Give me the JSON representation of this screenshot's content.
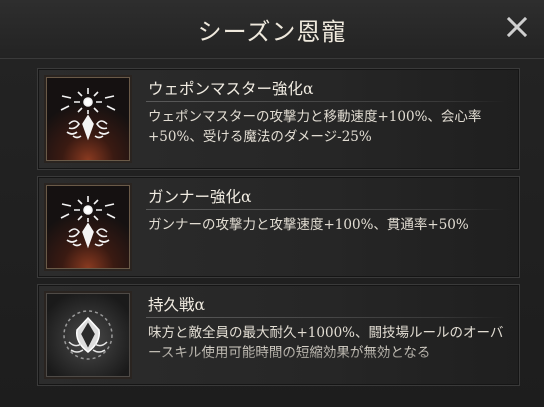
{
  "window": {
    "title": "シーズン恩寵"
  },
  "buffs": [
    {
      "name": "ウェポンマスター強化α",
      "description": "ウェポンマスターの攻撃力と移動速度+100%、会心率+50%、受ける魔法のダメージ-25%",
      "icon": "sun-weapon-emblem-icon"
    },
    {
      "name": "ガンナー強化α",
      "description": "ガンナーの攻撃力と攻撃速度+100%、貫通率+50%",
      "icon": "sun-weapon-emblem-icon"
    },
    {
      "name": "持久戦α",
      "description": "味方と敵全員の最大耐久+1000%、闘技場ルールのオーバースキル使用可能時間の短縮効果が無効となる",
      "icon": "shield-emblem-icon"
    }
  ],
  "colors": {
    "accent": "#6a5a48",
    "background": "#1b1b1b",
    "text": "#e8e2d6"
  }
}
